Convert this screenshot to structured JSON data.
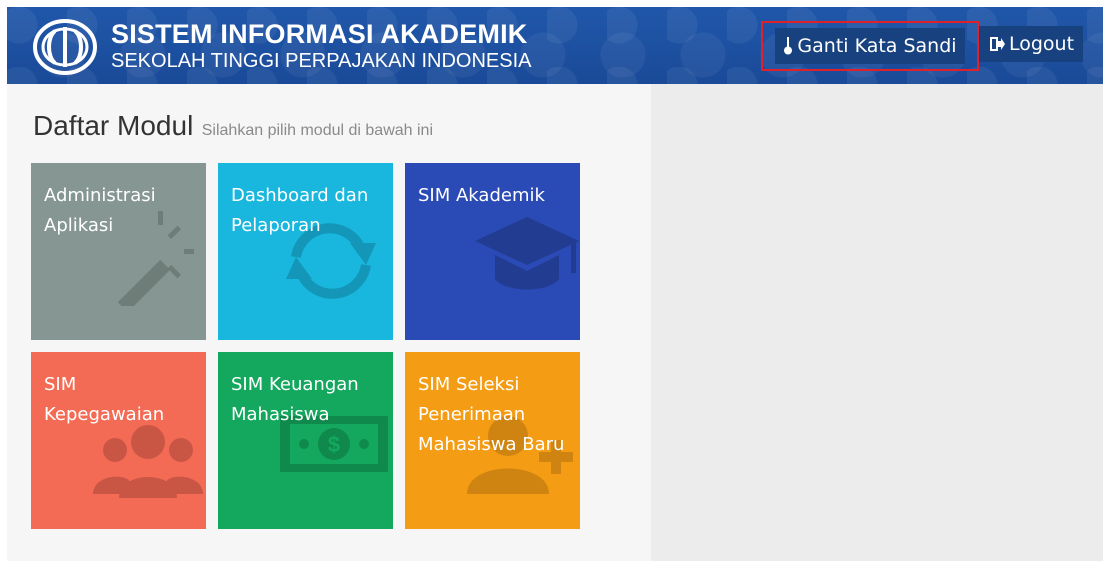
{
  "header": {
    "title": "SISTEM INFORMASI AKADEMIK",
    "subtitle": "SEKOLAH TINGGI PERPAJAKAN INDONESIA",
    "change_password_label": "Ganti Kata Sandi",
    "logout_label": "Logout",
    "background_color": "#1d4fa0"
  },
  "main": {
    "title": "Daftar Modul",
    "subtitle": "Silahkan pilih modul di bawah ini",
    "modules": [
      {
        "label": "Administrasi Aplikasi",
        "color": "#869692",
        "icon": "magic-wand-icon"
      },
      {
        "label": "Dashboard dan Pelaporan",
        "color": "#19b6de",
        "icon": "refresh-icon"
      },
      {
        "label": "SIM Akademik",
        "color": "#2a4ab5",
        "icon": "graduation-cap-icon"
      },
      {
        "label": "SIM Kepegawaian",
        "color": "#f46b55",
        "icon": "users-icon"
      },
      {
        "label": "SIM Keuangan Mahasiswa",
        "color": "#14a85e",
        "icon": "money-icon"
      },
      {
        "label": "SIM Seleksi Penerimaan Mahasiswa Baru",
        "color": "#f39c14",
        "icon": "user-plus-icon"
      }
    ]
  }
}
